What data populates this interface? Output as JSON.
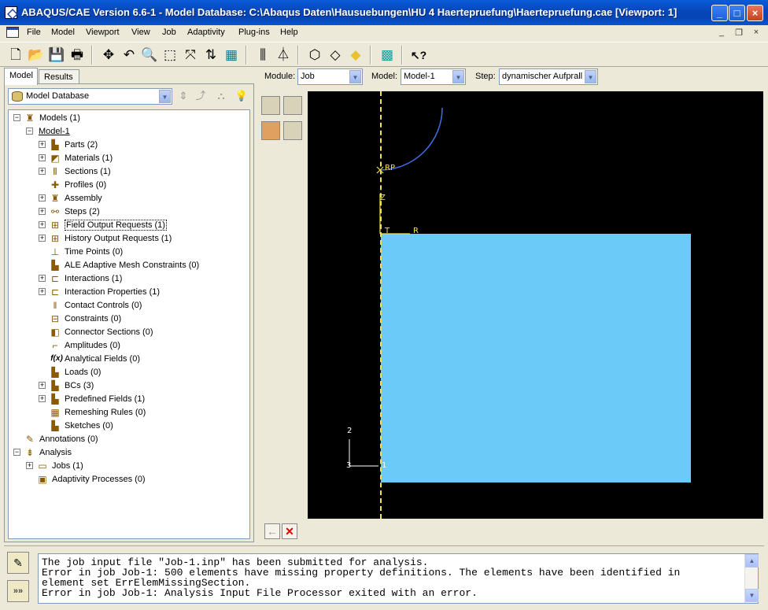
{
  "window": {
    "title": "ABAQUS/CAE Version 6.6-1 - Model Database: C:\\Abaqus Daten\\Hausuebungen\\HU 4 Haertepruefung\\Haertepruefung.cae [Viewport: 1]",
    "minimize": "_",
    "maximize": "□",
    "close": "×"
  },
  "menu": {
    "items": [
      "File",
      "Model",
      "Viewport",
      "View",
      "Job",
      "Adaptivity",
      "Plug-ins",
      "Help"
    ],
    "mdi_minimize": "_",
    "mdi_restore": "❐",
    "mdi_close": "×"
  },
  "toolbar": {
    "icons": [
      "new-icon",
      "open-icon",
      "save-icon",
      "print-icon",
      "pan-icon",
      "rotate-icon",
      "magnify-icon",
      "zoom-box-icon",
      "auto-fit-icon",
      "cycle-views-icon",
      "view-manager-icon",
      "perspective-icon",
      "parallel-icon",
      "wireframe-icon",
      "hidden-line-icon",
      "shaded-icon",
      "mesh-icon",
      "context-help-icon"
    ]
  },
  "left_panel": {
    "tabs": [
      "Model",
      "Results"
    ],
    "database_selector": "Model Database",
    "tree": [
      {
        "label": "Models (1)",
        "level": 0,
        "expander": "−",
        "icon": "models-icon"
      },
      {
        "label": "Model-1",
        "level": 1,
        "expander": "−",
        "icon": "",
        "underline": true
      },
      {
        "label": "Parts (2)",
        "level": 2,
        "expander": "+",
        "icon": "parts-icon"
      },
      {
        "label": "Materials (1)",
        "level": 2,
        "expander": "+",
        "icon": "materials-icon"
      },
      {
        "label": "Sections (1)",
        "level": 2,
        "expander": "+",
        "icon": "sections-icon"
      },
      {
        "label": "Profiles (0)",
        "level": 2,
        "expander": "",
        "icon": "profiles-icon"
      },
      {
        "label": "Assembly",
        "level": 2,
        "expander": "+",
        "icon": "assembly-icon"
      },
      {
        "label": "Steps (2)",
        "level": 2,
        "expander": "+",
        "icon": "steps-icon"
      },
      {
        "label": "Field Output Requests (1)",
        "level": 2,
        "expander": "+",
        "icon": "field-output-icon",
        "boxed": true
      },
      {
        "label": "History Output Requests (1)",
        "level": 2,
        "expander": "+",
        "icon": "history-output-icon"
      },
      {
        "label": "Time Points (0)",
        "level": 2,
        "expander": "",
        "icon": "time-points-icon"
      },
      {
        "label": "ALE Adaptive Mesh Constraints (0)",
        "level": 2,
        "expander": "",
        "icon": "ale-icon"
      },
      {
        "label": "Interactions (1)",
        "level": 2,
        "expander": "+",
        "icon": "interactions-icon"
      },
      {
        "label": "Interaction Properties (1)",
        "level": 2,
        "expander": "+",
        "icon": "interaction-properties-icon"
      },
      {
        "label": "Contact Controls (0)",
        "level": 2,
        "expander": "",
        "icon": "contact-controls-icon"
      },
      {
        "label": "Constraints (0)",
        "level": 2,
        "expander": "",
        "icon": "constraints-icon"
      },
      {
        "label": "Connector Sections (0)",
        "level": 2,
        "expander": "",
        "icon": "connector-sections-icon"
      },
      {
        "label": "Amplitudes (0)",
        "level": 2,
        "expander": "",
        "icon": "amplitudes-icon"
      },
      {
        "label": "Analytical Fields (0)",
        "level": 2,
        "expander": "",
        "icon": "analytical-fields-icon"
      },
      {
        "label": "Loads (0)",
        "level": 2,
        "expander": "",
        "icon": "loads-icon"
      },
      {
        "label": "BCs (3)",
        "level": 2,
        "expander": "+",
        "icon": "bcs-icon"
      },
      {
        "label": "Predefined Fields (1)",
        "level": 2,
        "expander": "+",
        "icon": "predefined-fields-icon"
      },
      {
        "label": "Remeshing Rules (0)",
        "level": 2,
        "expander": "",
        "icon": "remeshing-rules-icon"
      },
      {
        "label": "Sketches (0)",
        "level": 2,
        "expander": "",
        "icon": "sketches-icon"
      },
      {
        "label": "Annotations (0)",
        "level": 0,
        "expander": "",
        "icon": "annotations-icon"
      },
      {
        "label": "Analysis",
        "level": 0,
        "expander": "−",
        "icon": "analysis-icon"
      },
      {
        "label": "Jobs (1)",
        "level": 1,
        "expander": "+",
        "icon": "jobs-icon"
      },
      {
        "label": "Adaptivity Processes (0)",
        "level": 1,
        "expander": "",
        "icon": "adaptivity-processes-icon"
      }
    ],
    "analytical_fields_glyph": "f(x)"
  },
  "context_bar": {
    "module_label": "Module:",
    "module_value": "Job",
    "model_label": "Model:",
    "model_value": "Model-1",
    "step_label": "Step:",
    "step_value": "dynamischer Aufprall"
  },
  "viewport": {
    "labels": {
      "rp": "RP",
      "z": "Z",
      "t": "T",
      "r": "R",
      "axis2": "2",
      "axis3": "3",
      "axis1": "1"
    },
    "part_color": "#6ccaf9",
    "background": "#000000"
  },
  "messages": {
    "lines": [
      "The job input file \"Job-1.inp\" has been submitted for analysis.",
      "Error in job Job-1: 500 elements have missing property definitions. The elements have been identified in",
      "element set ErrElemMissingSection.",
      "Error in job Job-1: Analysis Input File Processor exited with an error."
    ],
    "command_glyph": "»»"
  }
}
